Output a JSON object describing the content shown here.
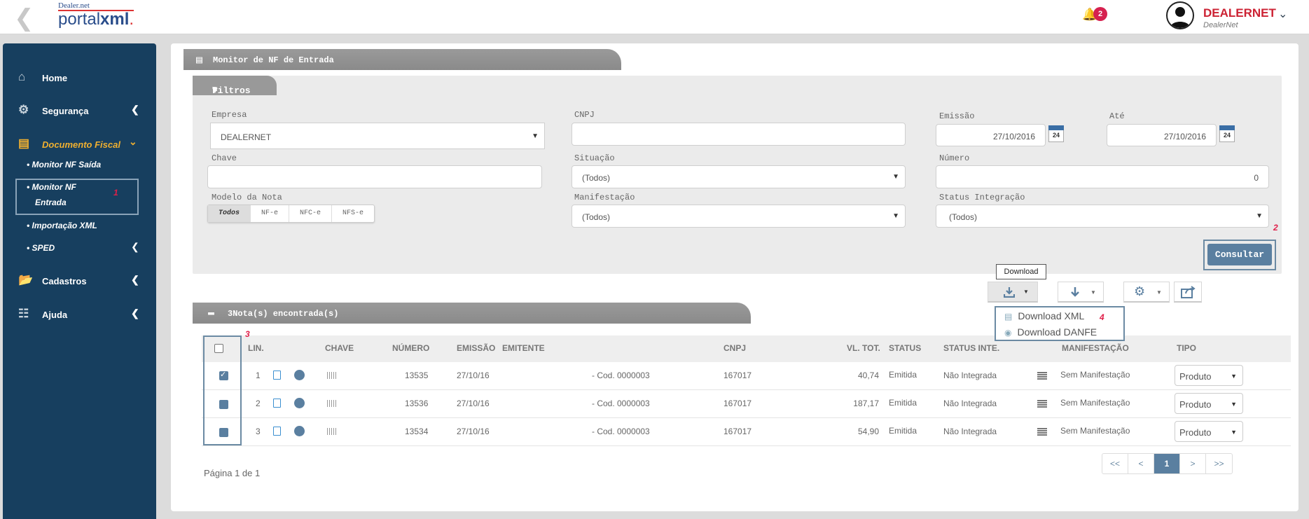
{
  "header": {
    "logo_small": "Dealer.net",
    "logo_main": "portal",
    "logo_bold": "xml",
    "logo_dot": ".",
    "notification_count": "2",
    "user_name": "DEALERNET",
    "user_sub": "DealerNet"
  },
  "sidebar": {
    "home": "Home",
    "seguranca": "Segurança",
    "documento_fiscal": "Documento Fiscal",
    "monitor_saida": "• Monitor NF Saída",
    "monitor_entrada_1": "• Monitor NF",
    "monitor_entrada_2": "Entrada",
    "importacao": "• Importação XML",
    "sped": "• SPED",
    "cadastros": "Cadastros",
    "ajuda": "Ajuda",
    "marker_1": "1"
  },
  "page": {
    "title": "Monitor de NF de Entrada",
    "filters_label": "Filtros"
  },
  "filters": {
    "empresa_label": "Empresa",
    "empresa_value": "DEALERNET",
    "cnpj_label": "CNPJ",
    "cnpj_value": "",
    "emissao_label": "Emissão",
    "emissao_value": "27/10/2016",
    "ate_label": "Até",
    "ate_value": "27/10/2016",
    "calendar_day": "24",
    "chave_label": "Chave",
    "chave_value": "",
    "situacao_label": "Situação",
    "situacao_value": "(Todos)",
    "numero_label": "Número",
    "numero_value": "0",
    "modelo_label": "Modelo da Nota",
    "modelo_options": [
      "Todos",
      "NF-e",
      "NFC-e",
      "NFS-e"
    ],
    "manifestacao_label": "Manifestação",
    "manifestacao_value": "(Todos)",
    "status_integracao_label": "Status Integração",
    "status_integracao_value": "(Todos)",
    "consultar_label": "Consultar",
    "marker_2": "2"
  },
  "toolbar": {
    "tooltip": "Download",
    "menu_xml": "Download XML",
    "menu_danfe": "Download DANFE",
    "marker_4": "4"
  },
  "results": {
    "title": "3Nota(s) encontrada(s)",
    "marker_3": "3",
    "columns": {
      "lin": "LIN.",
      "chave": "CHAVE",
      "numero": "NÚMERO",
      "emissao": "EMISSÃO",
      "emitente": "EMITENTE",
      "cnpj": "CNPJ",
      "vl_tot": "VL. TOT.",
      "status": "STATUS",
      "status_int": "STATUS INTE.",
      "manifestacao": "MANIFESTAÇÃO",
      "tipo": "TIPO"
    },
    "rows": [
      {
        "lin": "1",
        "numero": "13535",
        "emissao": "27/10/16",
        "emitente": "- Cod. 0000003",
        "cnpj": "167017",
        "vl_tot": "40,74",
        "status": "Emitida",
        "status_int": "Não Integrada",
        "manifestacao": "Sem Manifestação",
        "tipo": "Produto"
      },
      {
        "lin": "2",
        "numero": "13536",
        "emissao": "27/10/16",
        "emitente": "- Cod. 0000003",
        "cnpj": "167017",
        "vl_tot": "187,17",
        "status": "Emitida",
        "status_int": "Não Integrada",
        "manifestacao": "Sem Manifestação",
        "tipo": "Produto"
      },
      {
        "lin": "3",
        "numero": "13534",
        "emissao": "27/10/16",
        "emitente": "- Cod. 0000003",
        "cnpj": "167017",
        "vl_tot": "54,90",
        "status": "Emitida",
        "status_int": "Não Integrada",
        "manifestacao": "Sem Manifestação",
        "tipo": "Produto"
      }
    ],
    "page_info": "Página 1 de 1",
    "pager": [
      "<<",
      "<",
      "1",
      ">",
      ">>"
    ]
  },
  "icons": {
    "back": "chevron-left-icon",
    "bell": "bell-icon",
    "home": "home-icon",
    "gear": "gear-icon",
    "document": "document-icon",
    "folder": "folder-icon",
    "book": "book-icon",
    "pdf": "pdf-icon",
    "globe": "globe-icon"
  },
  "colors": {
    "sidebar_bg": "#173f5f",
    "accent": "#5a7fa0",
    "brand_red": "#cc2233",
    "active_menu": "#f0b030"
  }
}
